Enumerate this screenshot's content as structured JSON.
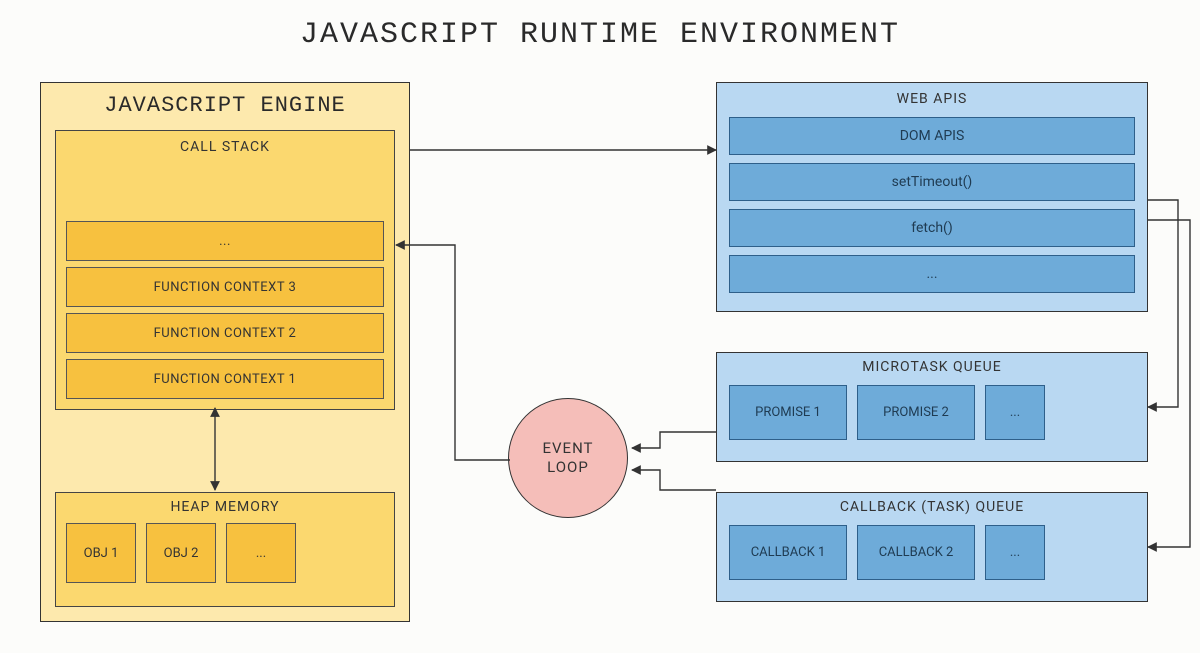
{
  "title": "JAVASCRIPT RUNTIME ENVIRONMENT",
  "engine": {
    "title": "JAVASCRIPT ENGINE",
    "callstack": {
      "title": "CALL STACK",
      "items": [
        "...",
        "FUNCTION CONTEXT 3",
        "FUNCTION CONTEXT 2",
        "FUNCTION CONTEXT 1"
      ]
    },
    "heap": {
      "title": "HEAP MEMORY",
      "items": [
        "OBJ 1",
        "OBJ 2",
        "..."
      ]
    }
  },
  "event_loop": {
    "label": "EVENT\nLOOP"
  },
  "web_apis": {
    "title": "WEB APIS",
    "items": [
      "DOM APIS",
      "setTimeout()",
      "fetch()",
      "..."
    ]
  },
  "microtask": {
    "title": "MICROTASK QUEUE",
    "items": [
      "PROMISE 1",
      "PROMISE 2",
      "..."
    ]
  },
  "callback": {
    "title": "CALLBACK (TASK) QUEUE",
    "items": [
      "CALLBACK 1",
      "CALLBACK 2",
      "..."
    ]
  },
  "colors": {
    "yellow_panel": "#fde9ad",
    "yellow_mid": "#fbd86f",
    "yellow_deep": "#f7c13f",
    "blue_panel": "#b9d8f2",
    "blue_deep": "#6eabd9",
    "pink": "#f5beb9"
  }
}
